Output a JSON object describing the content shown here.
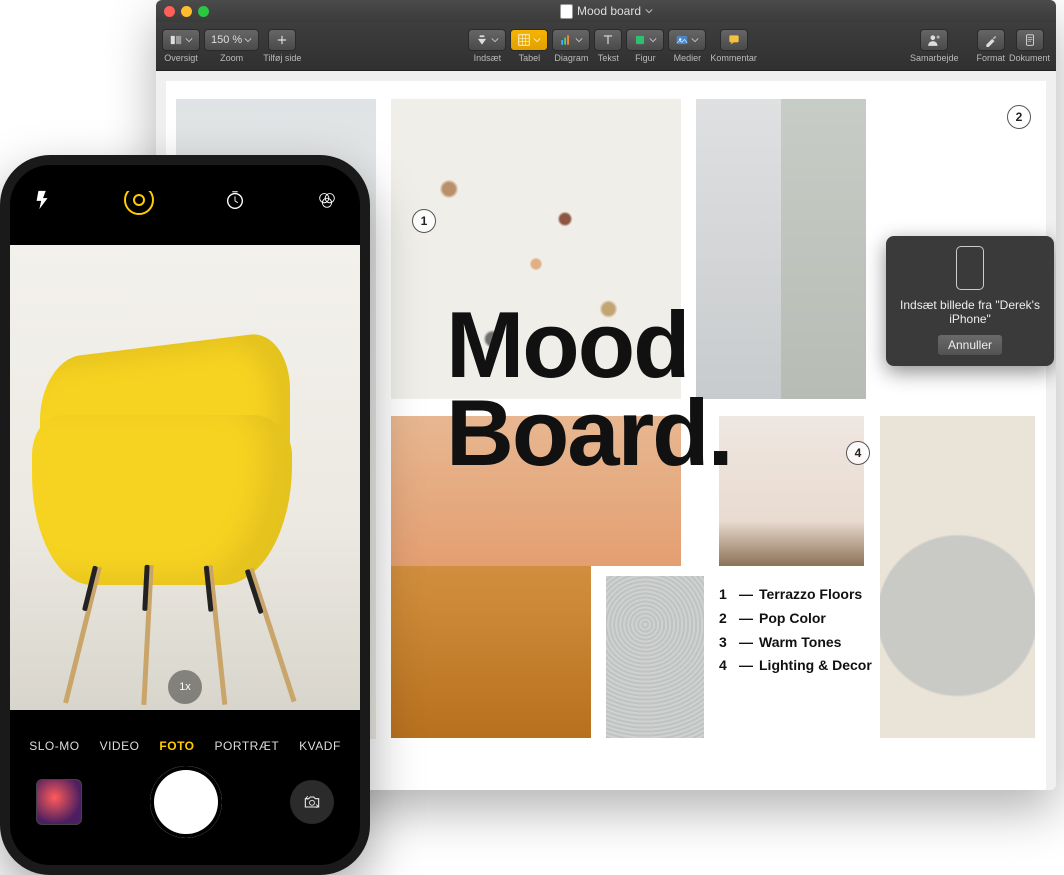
{
  "window": {
    "title": "Mood board",
    "toolbar": {
      "view": "Oversigt",
      "zoom_value": "150 %",
      "zoom_label": "Zoom",
      "add_page": "Tilføj side",
      "insert": "Indsæt",
      "table": "Tabel",
      "chart": "Diagram",
      "text": "Tekst",
      "shape": "Figur",
      "media": "Medier",
      "comment": "Kommentar",
      "collaborate": "Samarbejde",
      "format": "Format",
      "document": "Dokument"
    },
    "popover": {
      "text": "Indsæt billede fra \"Derek's iPhone\"",
      "cancel": "Annuller"
    }
  },
  "document": {
    "heading_line1": "Mood",
    "heading_line2": "Board.",
    "tags": {
      "1": "1",
      "2": "2",
      "4": "4"
    },
    "legend": [
      {
        "n": "1",
        "dash": "—",
        "t": "Terrazzo Floors"
      },
      {
        "n": "2",
        "dash": "—",
        "t": "Pop Color"
      },
      {
        "n": "3",
        "dash": "—",
        "t": "Warm Tones"
      },
      {
        "n": "4",
        "dash": "—",
        "t": "Lighting & Decor"
      }
    ]
  },
  "phone": {
    "zoom": "1x",
    "modes": {
      "slomo": "SLO-MO",
      "video": "VIDEO",
      "foto": "FOTO",
      "portrait": "PORTRÆT",
      "kvad": "KVADF"
    }
  }
}
